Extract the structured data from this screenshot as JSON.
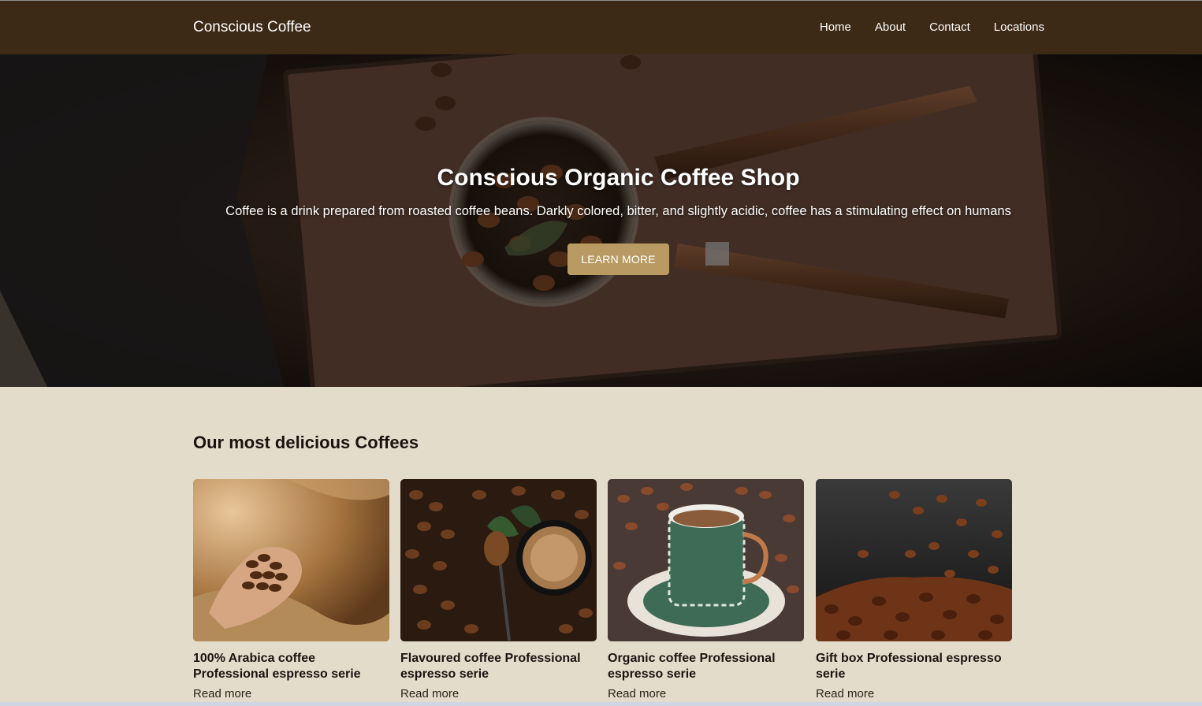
{
  "nav": {
    "brand": "Conscious Coffee",
    "links": [
      "Home",
      "About",
      "Contact",
      "Locations"
    ]
  },
  "hero": {
    "title": "Conscious Organic Coffee Shop",
    "text": "Coffee is a drink prepared from roasted coffee beans. Darkly colored, bitter, and slightly acidic, coffee has a stimulating effect on humans",
    "button": "LEARN MORE"
  },
  "products": {
    "heading": "Our most delicious Coffees",
    "items": [
      {
        "title": "100% Arabica coffee Professional espresso serie",
        "link": "Read more"
      },
      {
        "title": "Flavoured coffee Professional espresso serie",
        "link": "Read more"
      },
      {
        "title": "Organic coffee Professional espresso serie",
        "link": "Read more"
      },
      {
        "title": "Gift box Professional espresso serie",
        "link": "Read more"
      }
    ]
  },
  "colors": {
    "navbar": "#3c2916",
    "button": "#b89a62",
    "page_background": "#e3dccb"
  }
}
